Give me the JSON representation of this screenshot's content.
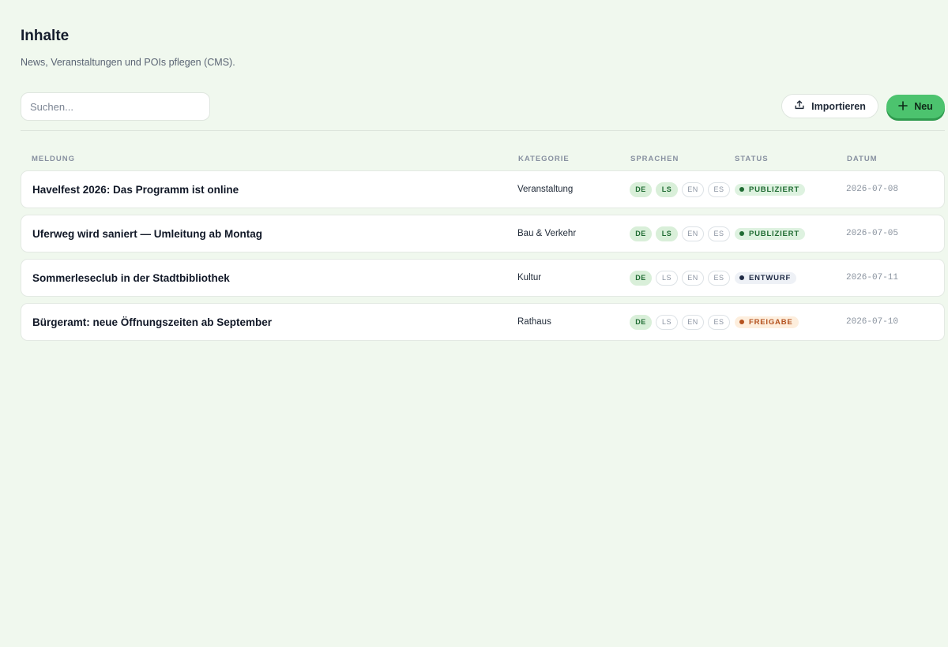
{
  "header": {
    "title": "Inhalte",
    "subtitle": "News, Veranstaltungen und POIs pflegen (CMS)."
  },
  "toolbar": {
    "search_placeholder": "Suchen...",
    "search_value": "",
    "import_label": "Importieren",
    "import_icon": "upload-icon",
    "new_label": "Neu",
    "new_icon": "plus-icon"
  },
  "table": {
    "columns": [
      "MELDUNG",
      "KATEGORIE",
      "SPRACHEN",
      "STATUS",
      "DATUM"
    ],
    "rows": [
      {
        "title": "Havelfest 2026: Das Programm ist online",
        "category": "Veranstaltung",
        "languages": [
          {
            "code": "DE",
            "active": true
          },
          {
            "code": "LS",
            "active": true
          },
          {
            "code": "EN",
            "active": false
          },
          {
            "code": "ES",
            "active": false
          }
        ],
        "status": "PUBLIZIERT",
        "status_kind": "published",
        "date": "2026-07-08"
      },
      {
        "title": "Uferweg wird saniert — Umleitung ab Montag",
        "category": "Bau & Verkehr",
        "languages": [
          {
            "code": "DE",
            "active": true
          },
          {
            "code": "LS",
            "active": true
          },
          {
            "code": "EN",
            "active": false
          },
          {
            "code": "ES",
            "active": false
          }
        ],
        "status": "PUBLIZIERT",
        "status_kind": "published",
        "date": "2026-07-05"
      },
      {
        "title": "Sommerleseclub in der Stadtbibliothek",
        "category": "Kultur",
        "languages": [
          {
            "code": "DE",
            "active": true
          },
          {
            "code": "LS",
            "active": false
          },
          {
            "code": "EN",
            "active": false
          },
          {
            "code": "ES",
            "active": false
          }
        ],
        "status": "ENTWURF",
        "status_kind": "draft",
        "date": "2026-07-11"
      },
      {
        "title": "Bürgeramt: neue Öffnungszeiten ab September",
        "category": "Rathaus",
        "languages": [
          {
            "code": "DE",
            "active": true
          },
          {
            "code": "LS",
            "active": false
          },
          {
            "code": "EN",
            "active": false
          },
          {
            "code": "ES",
            "active": false
          }
        ],
        "status": "FREIGABE",
        "status_kind": "review",
        "date": "2026-07-10"
      }
    ]
  },
  "colors": {
    "background": "#f0f8ee",
    "accent": "#4cc36e",
    "status_published_bg": "#def2e0",
    "status_published_fg": "#1f6b32",
    "status_draft_bg": "#eef1f6",
    "status_draft_fg": "#1f2a44",
    "status_review_bg": "#fdeedd",
    "status_review_fg": "#b4521f"
  }
}
